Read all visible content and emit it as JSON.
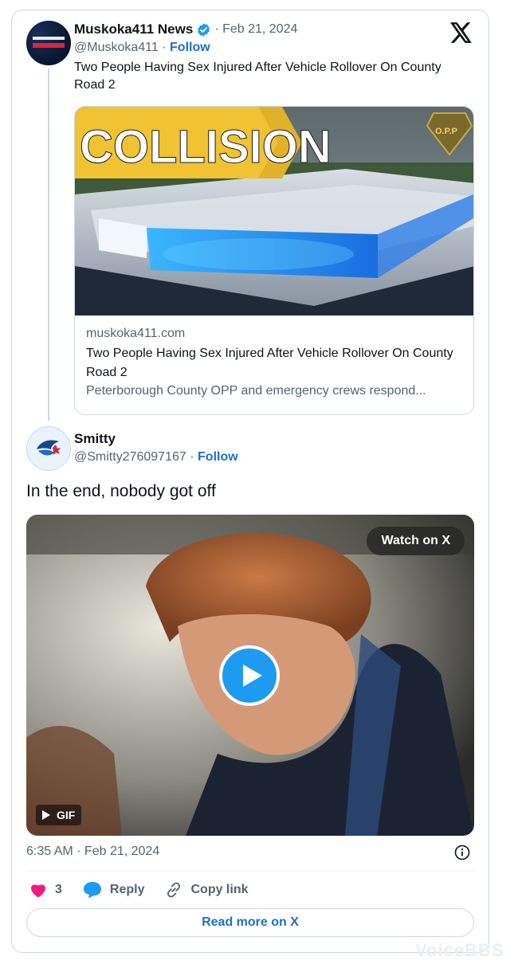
{
  "quoted": {
    "name": "Muskoka411 News",
    "date": "Feb 21, 2024",
    "handle": "@Muskoka411",
    "follow": "Follow",
    "text": "Two People Having Sex Injured After Vehicle Rollover On County Road 2",
    "card": {
      "image_text": "COLLISION",
      "badge_text": "O.P.P",
      "domain": "muskoka411.com",
      "title": "Two People Having Sex Injured After Vehicle Rollover On County Road 2",
      "description": "Peterborough County OPP and emergency crews respond..."
    }
  },
  "reply": {
    "name": "Smitty",
    "handle": "@Smitty276097167",
    "follow": "Follow",
    "text": "In the end, nobody got off",
    "media": {
      "watch_label": "Watch on X",
      "gif_label": "GIF"
    },
    "timestamp": "6:35 AM · Feb 21, 2024",
    "likes": "3",
    "reply_label": "Reply",
    "copy_label": "Copy link",
    "read_more": "Read more on X"
  },
  "separator": "·",
  "watermark": "VoiceBBS",
  "colors": {
    "link_blue": "#1d70c9",
    "verified_blue": "#1d9bf0",
    "like_pink": "#f91880",
    "secondary_text": "#536471",
    "border": "#cfd9de"
  },
  "icons": [
    "x-logo-icon",
    "verified-badge-icon",
    "play-icon",
    "info-icon",
    "heart-icon",
    "reply-bubble-icon",
    "link-icon"
  ]
}
